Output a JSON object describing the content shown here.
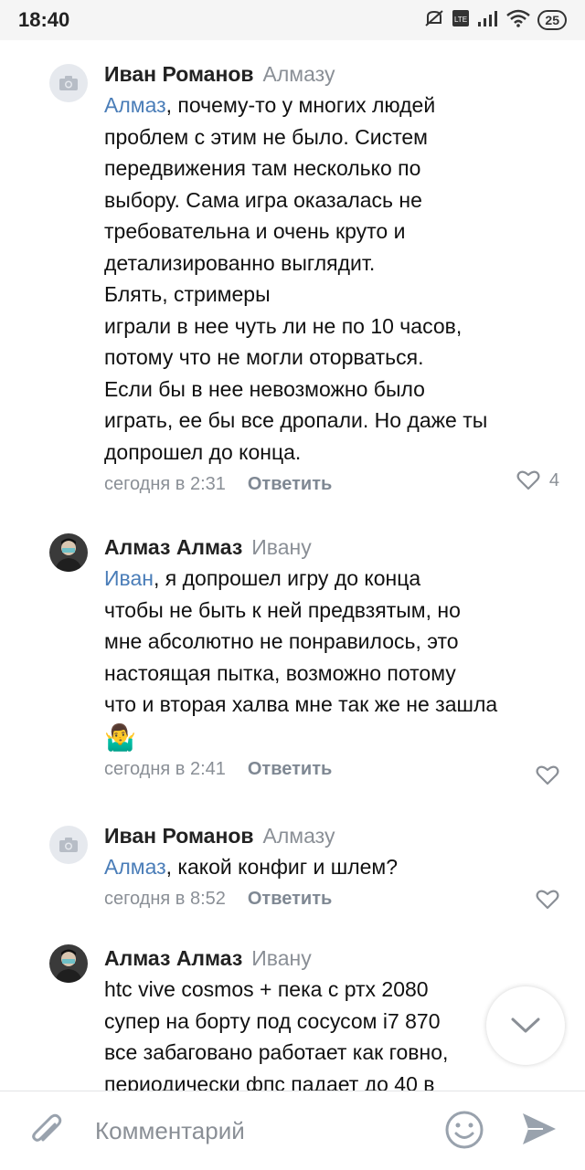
{
  "status_bar": {
    "time": "18:40",
    "battery": "25"
  },
  "comments": [
    {
      "author": "Иван Романов",
      "reply_to": "Алмазу",
      "mention": "Алмаз",
      "text": ", почему-то у многих людей\nпроблем с этим не было. Систем\nпередвижения там несколько по\nвыбору. Сама игра оказалась не\nтребовательна и очень круто и\nдетализированно выглядит.\nБлять, стримеры\nиграли в нее чуть ли не по 10 часов,\nпотому что не могли оторваться.\nЕсли бы в нее невозможно было\nиграть, ее бы все дропали. Но даже ты\nдопрошел до конца.",
      "time": "сегодня в 2:31",
      "reply_label": "Ответить",
      "likes": "4"
    },
    {
      "author": "Алмаз Алмаз",
      "reply_to": "Ивану",
      "mention": "Иван",
      "text": ", я допрошел игру до конца\nчтобы не быть к ней предвзятым, но\nмне абсолютно не понравилось, это\nнастоящая пытка, возможно потому\nчто и вторая халва мне так же не зашла",
      "emoji": "🤷‍♂️",
      "time": "сегодня в 2:41",
      "reply_label": "Ответить"
    },
    {
      "author": "Иван Романов",
      "reply_to": "Алмазу",
      "mention": "Алмаз",
      "text": ", какой конфиг и шлем?",
      "time": "сегодня в 8:52",
      "reply_label": "Ответить"
    },
    {
      "author": "Алмаз Алмаз",
      "reply_to": "Ивану",
      "text": "htc vive cosmos + пека с ртх 2080\nсупер на борту под сосусом i7 870\nвсе забаговано работает как говно,\nпериодически фпс падает до 40 в"
    }
  ],
  "composer": {
    "placeholder": "Комментарий"
  },
  "icons": {
    "attach": "paperclip-icon",
    "emoji": "smile-icon",
    "send": "send-icon",
    "like": "heart-icon",
    "scroll": "chevron-down-icon"
  },
  "colors": {
    "mention": "#4a7db8",
    "meta": "#8a8f96"
  }
}
